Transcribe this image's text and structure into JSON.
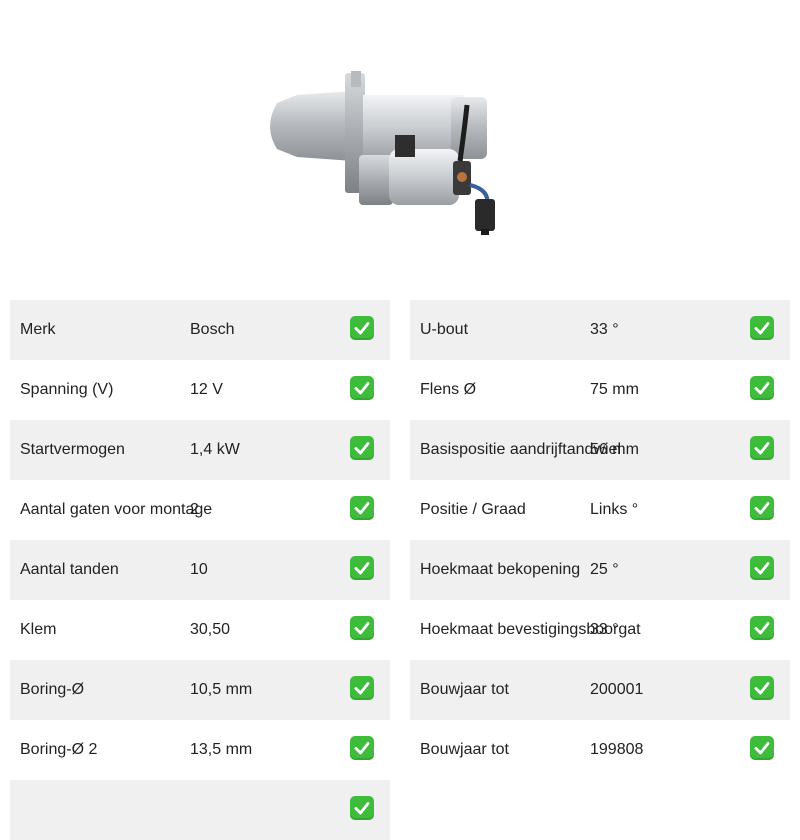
{
  "product": {
    "image_icon": "starter-motor-image"
  },
  "specs_left": [
    {
      "label": "Merk",
      "value": "Bosch"
    },
    {
      "label": "Spanning (V)",
      "value": "12 V"
    },
    {
      "label": "Startvermogen",
      "value": "1,4 kW"
    },
    {
      "label": "Aantal gaten voor montage",
      "value": "2"
    },
    {
      "label": "Aantal tanden",
      "value": "10"
    },
    {
      "label": "Klem",
      "value": "30,50"
    },
    {
      "label": "Boring-Ø",
      "value": "10,5 mm"
    },
    {
      "label": "Boring-Ø 2",
      "value": "13,5 mm"
    },
    {
      "label": "",
      "value": ""
    }
  ],
  "specs_right": [
    {
      "label": "U-bout",
      "value": "33 °"
    },
    {
      "label": "Flens Ø",
      "value": "75 mm"
    },
    {
      "label": "Basispositie aandrijftandwiel",
      "value": "56 mm"
    },
    {
      "label": "Positie / Graad",
      "value": "Links °"
    },
    {
      "label": "Hoekmaat bekopening",
      "value": "25 °"
    },
    {
      "label": "Hoekmaat bevestigingsboorgat",
      "value": "33 °"
    },
    {
      "label": "Bouwjaar tot",
      "value": "200001"
    },
    {
      "label": "Bouwjaar tot",
      "value": "199808"
    }
  ],
  "colors": {
    "row_shade": "#f0f0f0",
    "check": "#3dbd3b"
  }
}
